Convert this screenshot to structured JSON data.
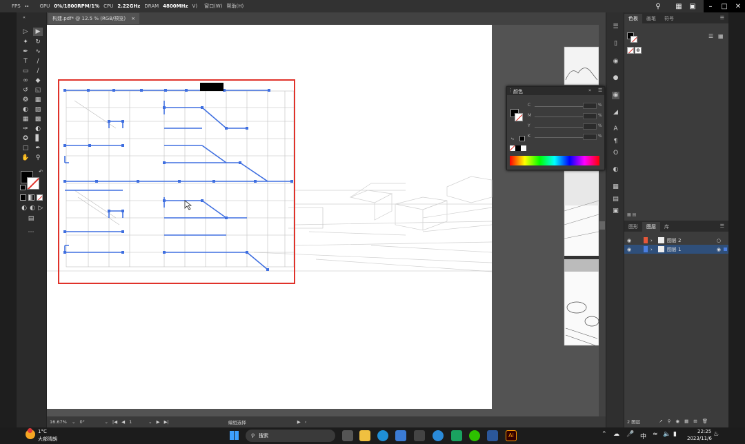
{
  "topbar": {
    "fps": "FPS",
    "fps_value": "--",
    "gpu_label": "GPU",
    "gpu_value": "0%/1800RPM/1%",
    "cpu_label": "CPU",
    "cpu_value": "2.22GHz",
    "dram_label": "DRAM",
    "dram_value": "4800MHz",
    "menu_window": "窗口(W)",
    "menu_help": "帮助(H)",
    "menu_view": "V)"
  },
  "document": {
    "tab_title": "构建.pdf* @ 12.5 % (RGB/预览)",
    "tab_close": "×"
  },
  "status": {
    "zoom": "16.67%",
    "rotation": "0°",
    "page": "1",
    "tool": "编组选择"
  },
  "swatch_panel": {
    "tabs": [
      "色板",
      "画笔",
      "符号"
    ]
  },
  "color_panel": {
    "title": "颜色",
    "channels": [
      "C",
      "M",
      "Y",
      "K"
    ],
    "percent": "%"
  },
  "layers_panel": {
    "tabs": [
      "图形",
      "图层",
      "库"
    ],
    "layers": [
      {
        "name": "图层 2",
        "color": "#e5573a"
      },
      {
        "name": "图层 1",
        "color": "#4a7ee0"
      }
    ],
    "count_label": "2 图层"
  },
  "taskbar": {
    "temperature": "1°C",
    "weather": "大部晴朗",
    "search_label": "搜索",
    "time": "22:25",
    "date": "2023/11/6",
    "ime": "中",
    "ai_label": "Ai"
  },
  "colors": {
    "selection_red": "#e0322a",
    "selection_blue": "#3f6fe0",
    "layer_highlight": "#2f4f7a"
  }
}
